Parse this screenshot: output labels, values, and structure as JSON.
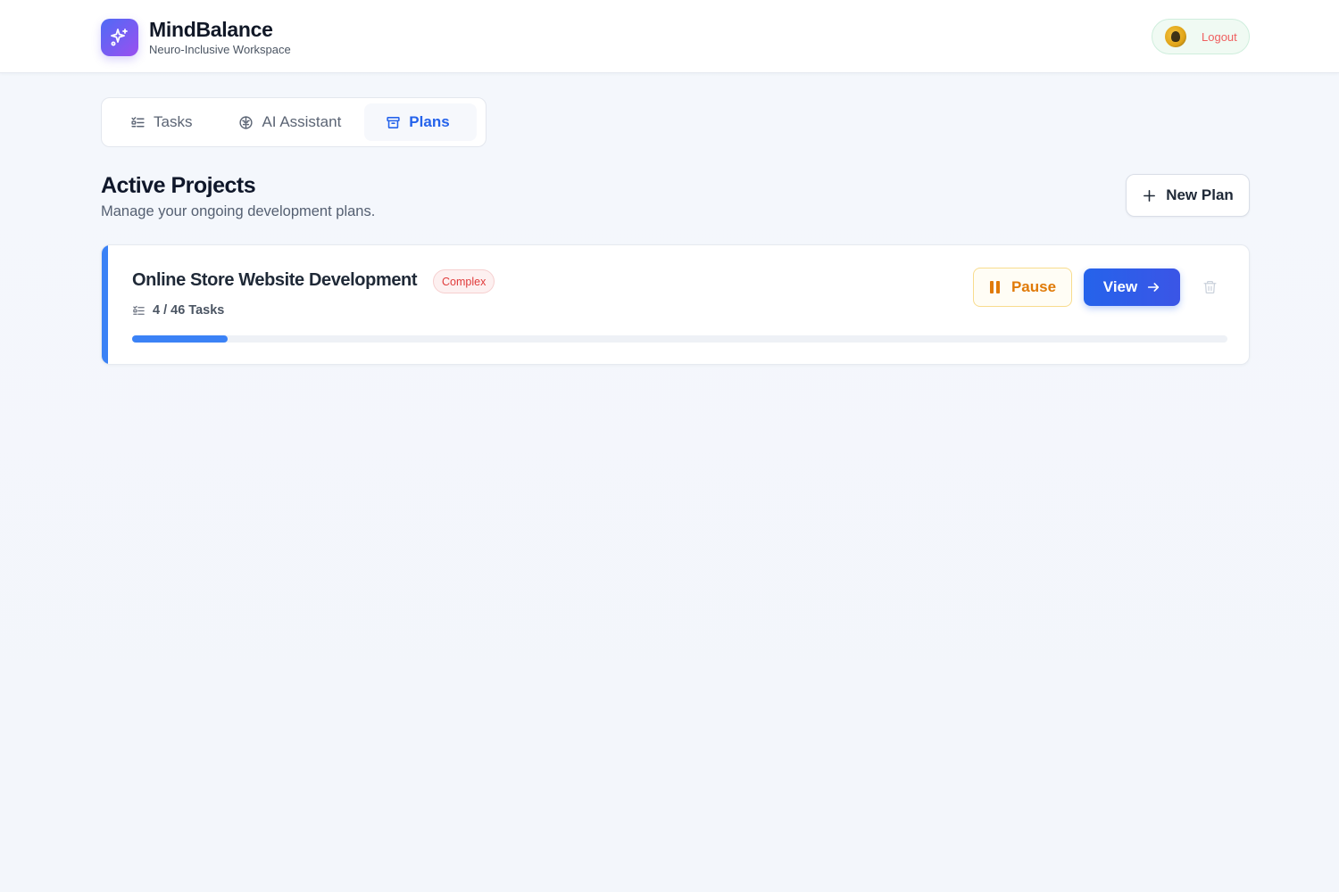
{
  "header": {
    "app_name": "MindBalance",
    "app_subtitle": "Neuro-Inclusive Workspace",
    "logo_icon": "sparkles-icon",
    "avatar_icon": "user-avatar",
    "logout_label": "Logout"
  },
  "tabs": [
    {
      "label": "Tasks",
      "icon": "list-checks-icon",
      "active": false
    },
    {
      "label": "AI Assistant",
      "icon": "brain-icon",
      "active": false
    },
    {
      "label": "Plans",
      "icon": "archive-icon",
      "active": true
    }
  ],
  "section": {
    "title": "Active Projects",
    "subtitle": "Manage your ongoing development plans.",
    "new_plan_label": "New Plan"
  },
  "projects": [
    {
      "title": "Online Store Website Development",
      "complexity": "Complex",
      "tasks_done": 4,
      "tasks_total": 46,
      "tasks_text": "4 / 46 Tasks",
      "progress_fraction": 0.087,
      "pause_label": "Pause",
      "view_label": "View"
    }
  ],
  "colors": {
    "accent": "#2563eb",
    "progress": "#3b82f6",
    "badge_text": "#e03b3b",
    "pause": "#e07a08",
    "logout": "#ef5f5f"
  }
}
